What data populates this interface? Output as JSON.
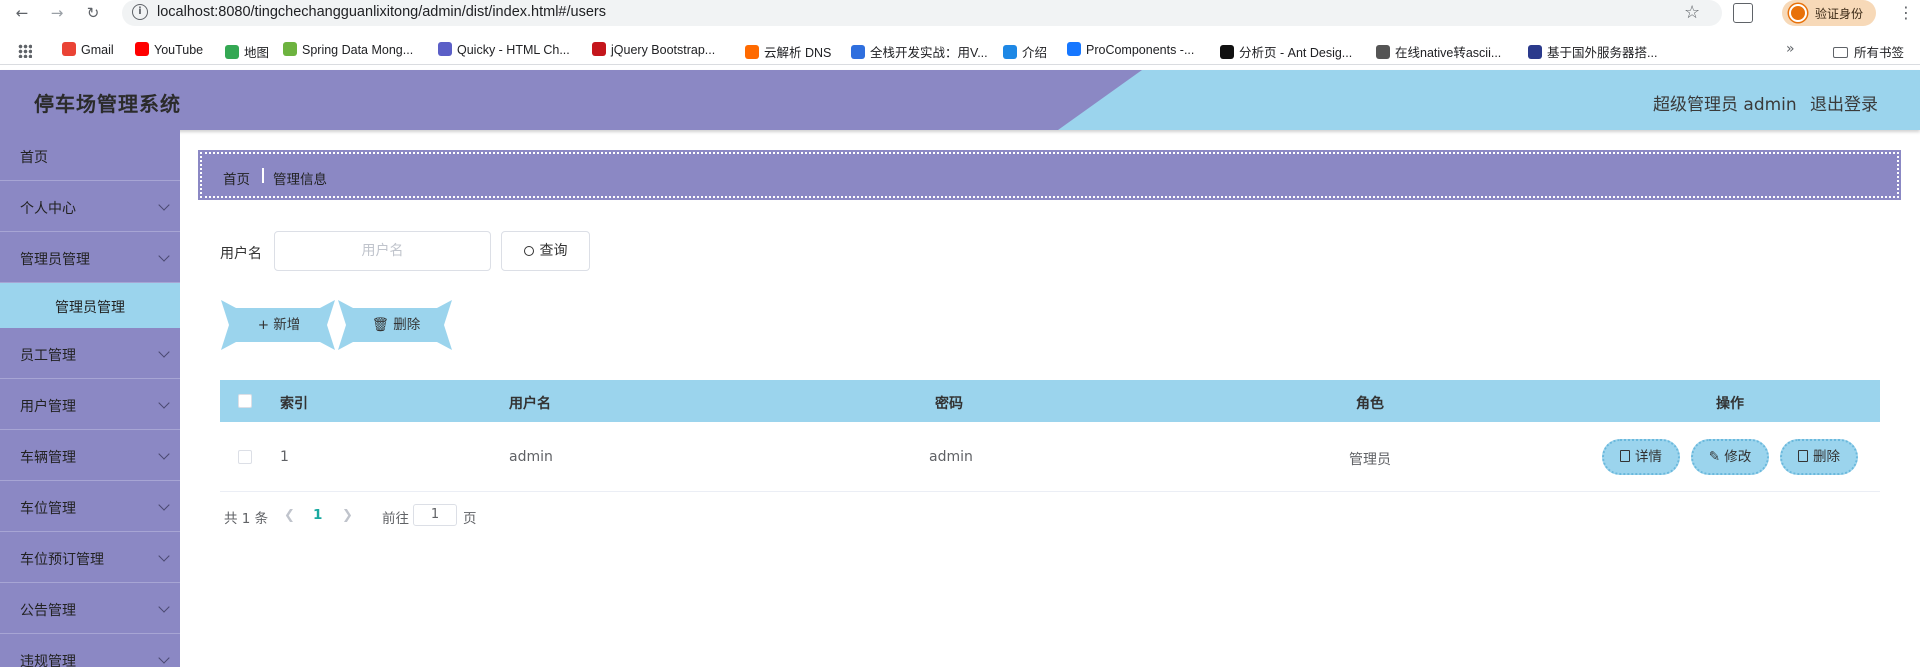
{
  "browser": {
    "url": "localhost:8080/tingchechangguanlixitong/admin/dist/index.html#/users",
    "profile_label": "验证身份",
    "bookmarks": [
      {
        "label": "Gmail",
        "color": "#ea4335"
      },
      {
        "label": "YouTube",
        "color": "#ff0000"
      },
      {
        "label": "地图",
        "color": "#34a853"
      },
      {
        "label": "Spring Data Mong...",
        "color": "#6db33f"
      },
      {
        "label": "Quicky - HTML Ch...",
        "color": "#5b5fc7"
      },
      {
        "label": "jQuery Bootstrap...",
        "color": "#c4161c"
      },
      {
        "label": "云解析 DNS",
        "color": "#ff6a00"
      },
      {
        "label": "全栈开发实战：用V...",
        "color": "#2f6fde"
      },
      {
        "label": "介绍",
        "color": "#1e88e5"
      },
      {
        "label": "ProComponents -...",
        "color": "#1677ff"
      },
      {
        "label": "分析页 - Ant Desig...",
        "color": "#111111"
      },
      {
        "label": "在线native转ascii...",
        "color": "#555555"
      },
      {
        "label": "基于国外服务器搭...",
        "color": "#2b3a8c"
      }
    ],
    "bookmarks_folder": "所有书签"
  },
  "header": {
    "title": "停车场管理系统",
    "user": "超级管理员 admin",
    "logout": "退出登录"
  },
  "sidebar": {
    "items": [
      {
        "label": "首页",
        "has_arrow": false
      },
      {
        "label": "个人中心",
        "has_arrow": true
      },
      {
        "label": "管理员管理",
        "has_arrow": true
      },
      {
        "label": "员工管理",
        "has_arrow": true
      },
      {
        "label": "用户管理",
        "has_arrow": true
      },
      {
        "label": "车辆管理",
        "has_arrow": true
      },
      {
        "label": "车位管理",
        "has_arrow": true
      },
      {
        "label": "车位预订管理",
        "has_arrow": true
      },
      {
        "label": "公告管理",
        "has_arrow": true
      },
      {
        "label": "违规管理",
        "has_arrow": true
      }
    ],
    "active_sub": "管理员管理"
  },
  "breadcrumb": {
    "home": "首页",
    "current": "管理信息"
  },
  "search": {
    "label": "用户名",
    "placeholder": "用户名",
    "button": "查询"
  },
  "actions": {
    "add": "新增",
    "delete": "删除"
  },
  "table": {
    "headers": [
      "索引",
      "用户名",
      "密码",
      "角色",
      "操作"
    ],
    "rows": [
      {
        "index": "1",
        "username": "admin",
        "password": "admin",
        "role": "管理员"
      }
    ],
    "row_actions": [
      "详情",
      "修改",
      "删除"
    ]
  },
  "pagination": {
    "total": "共 1 条",
    "current_page": "1",
    "goto_prefix": "前往",
    "goto_value": "1",
    "goto_suffix": "页"
  },
  "colors": {
    "purple": "#8b88c4",
    "light_blue": "#9bd4ed",
    "page_active": "#19a9a0"
  }
}
